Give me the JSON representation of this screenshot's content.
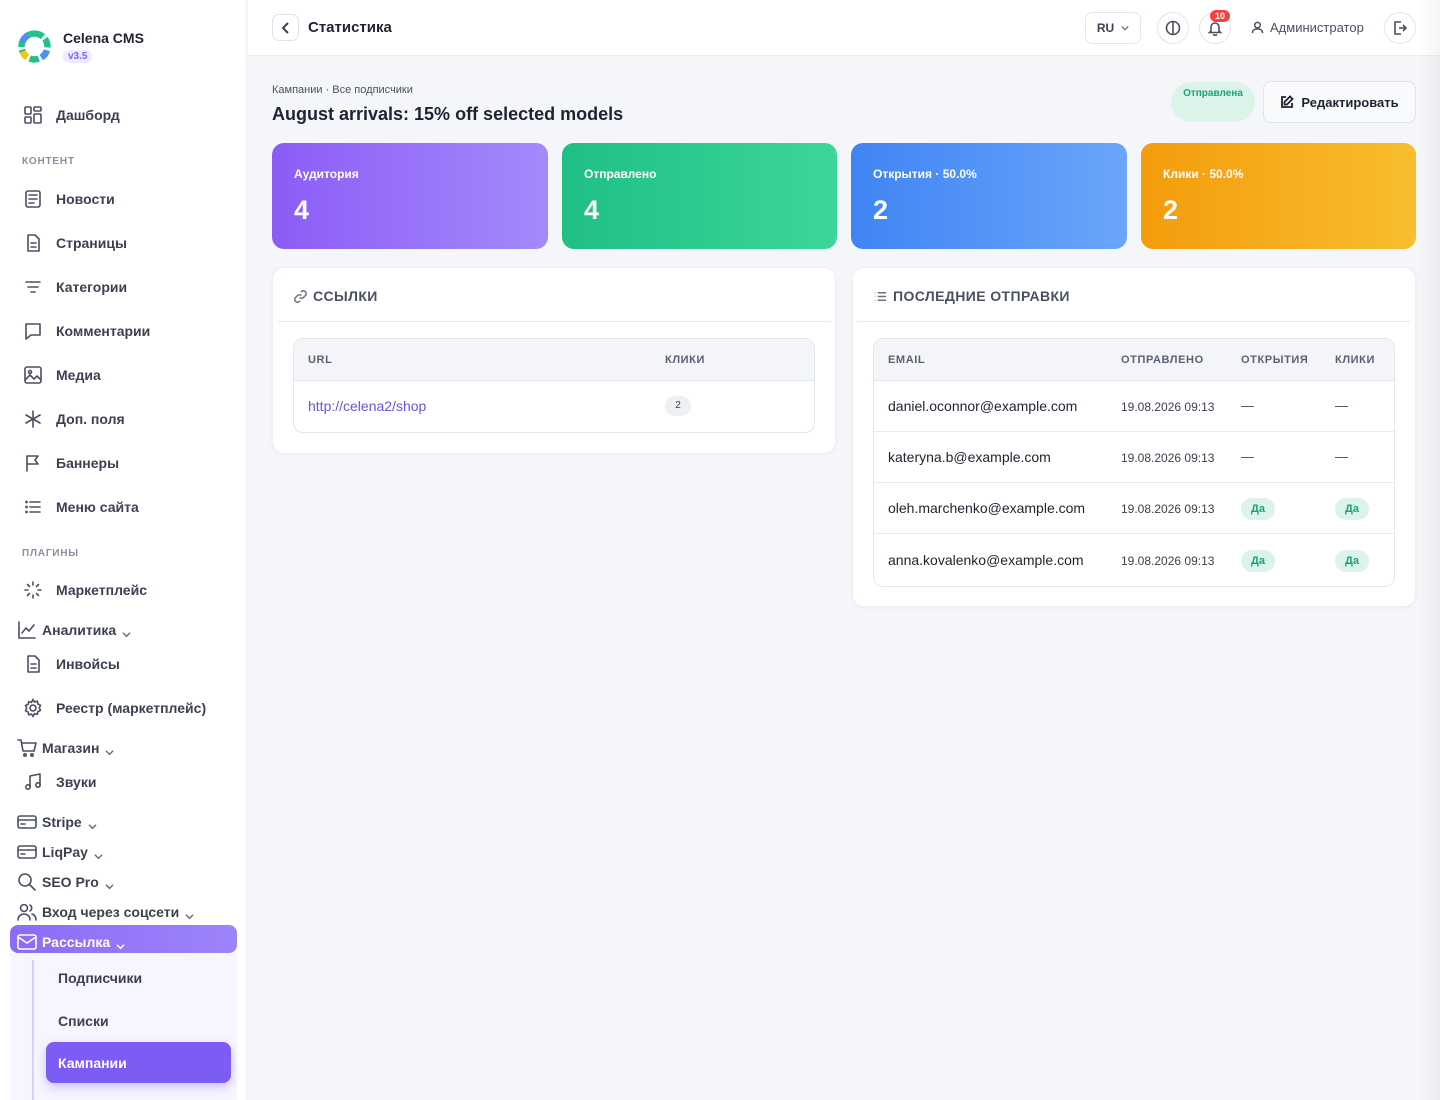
{
  "brand": {
    "name": "Celena CMS",
    "version": "v3.5"
  },
  "sidebar": {
    "dashboard": "Дашборд",
    "section_content": "КОНТЕНТ",
    "content_items": [
      "Новости",
      "Страницы",
      "Категории",
      "Комментарии",
      "Медиа",
      "Доп. поля",
      "Баннеры",
      "Меню сайта"
    ],
    "section_plugins": "ПЛАГИНЫ",
    "plugin_items": {
      "marketplace": "Маркетплейс",
      "analytics": "Аналитика",
      "invoices": "Инвойсы",
      "registry": "Реестр (маркетплейс)",
      "shop": "Магазин",
      "sounds": "Звуки",
      "stripe": "Stripe",
      "liqpay": "LiqPay",
      "seo": "SEO Pro",
      "social": "Вход через соцсети",
      "mailing": "Рассылка"
    },
    "submenu": [
      "Подписчики",
      "Списки",
      "Кампании"
    ]
  },
  "topbar": {
    "title": "Статистика",
    "lang": "RU",
    "notifications": "10",
    "user": "Администратор"
  },
  "header": {
    "breadcrumb": "Кампании · Все подписчики",
    "title": "August arrivals: 15% off selected models",
    "status": "Отправлена",
    "edit_label": "Редактировать"
  },
  "stats": [
    {
      "label": "Аудитория",
      "value": "4"
    },
    {
      "label": "Отправлено",
      "value": "4"
    },
    {
      "label": "Открытия · 50.0%",
      "value": "2"
    },
    {
      "label": "Клики · 50.0%",
      "value": "2"
    }
  ],
  "links_panel": {
    "title": "ССЫЛКИ",
    "columns": [
      "URL",
      "КЛИКИ"
    ],
    "rows": [
      {
        "url": "http://celena2/shop",
        "clicks": "2"
      }
    ]
  },
  "sends_panel": {
    "title": "ПОСЛЕДНИЕ ОТПРАВКИ",
    "columns": [
      "EMAIL",
      "ОТПРАВЛЕНО",
      "ОТКРЫТИЯ",
      "КЛИКИ"
    ],
    "rows": [
      {
        "email": "daniel.oconnor@example.com",
        "sent": "19.08.2026 09:13",
        "opens": "—",
        "clicks": "—"
      },
      {
        "email": "kateryna.b@example.com",
        "sent": "19.08.2026 09:13",
        "opens": "—",
        "clicks": "—"
      },
      {
        "email": "oleh.marchenko@example.com",
        "sent": "19.08.2026 09:13",
        "opens": "Да",
        "clicks": "Да"
      },
      {
        "email": "anna.kovalenko@example.com",
        "sent": "19.08.2026 09:13",
        "opens": "Да",
        "clicks": "Да"
      }
    ]
  },
  "colors": {
    "accent": "#7c5cf5",
    "stat_audience": "#8b5cf6",
    "stat_sent": "#22c08a",
    "stat_opens": "#4f8ef5",
    "stat_clicks": "#f5a616",
    "success": "#1aa374"
  }
}
